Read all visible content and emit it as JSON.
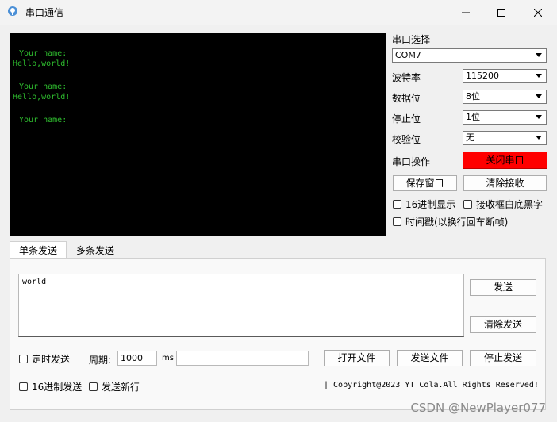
{
  "window": {
    "title": "串口通信",
    "icon": "app-icon"
  },
  "terminal": {
    "lines": [
      " Your name:",
      "Hello,world!",
      "",
      " Your name:",
      "Hello,world!",
      "",
      " Your name:"
    ],
    "text_color": "#2fbf2f",
    "bg_color": "#000000"
  },
  "serial": {
    "port_label": "串口选择",
    "port_value": "COM7",
    "baud_label": "波特率",
    "baud_value": "115200",
    "databits_label": "数据位",
    "databits_value": "8位",
    "stopbits_label": "停止位",
    "stopbits_value": "1位",
    "parity_label": "校验位",
    "parity_value": "无",
    "op_label": "串口操作",
    "close_port_button": "关闭串口",
    "close_port_color": "#ff0000",
    "save_window_button": "保存窗口",
    "clear_receive_button": "清除接收",
    "hex_display_checkbox": "16进制显示",
    "white_bg_black_text_checkbox": "接收框白底黑字",
    "timestamp_checkbox": "时间戳(以换行回车断帧)"
  },
  "tabs": [
    {
      "label": "单条发送",
      "active": true
    },
    {
      "label": "多条发送",
      "active": false
    }
  ],
  "send": {
    "text": "world",
    "send_button": "发送",
    "clear_send_button": "清除发送",
    "timed_send_checkbox": "定时发送",
    "period_label": "周期:",
    "period_value": "1000",
    "period_unit": "ms",
    "file_path_value": "",
    "open_file_button": "打开文件",
    "send_file_button": "发送文件",
    "stop_send_button": "停止发送",
    "hex_send_checkbox": "16进制发送",
    "send_newline_checkbox": "发送新行",
    "copyright": "| Copyright@2023 YT Cola.All Rights Reserved!"
  },
  "watermark": "CSDN @NewPlayer077"
}
